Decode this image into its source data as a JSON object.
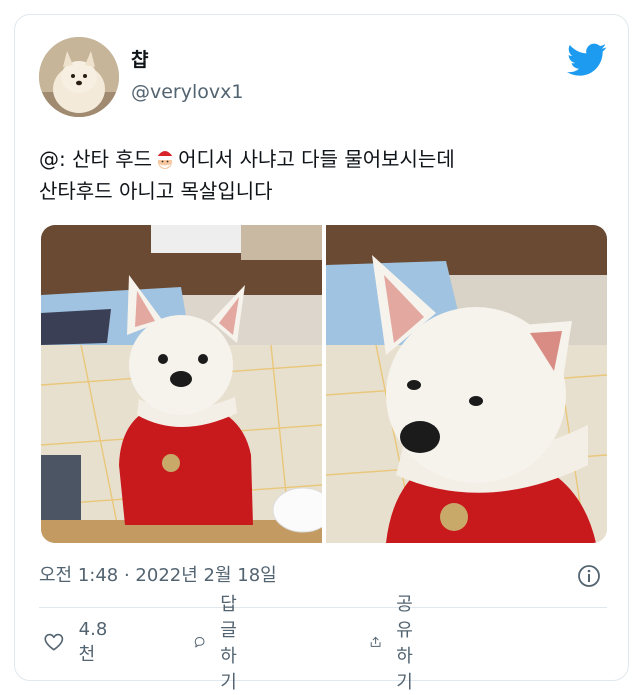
{
  "author": {
    "display_name": "챱",
    "handle": "@verylovx1",
    "avatar_icon": "dog-avatar"
  },
  "tweet": {
    "line1_before_emoji": "@: 산타 후드",
    "emoji": "santa-hat-emoji",
    "line1_after_emoji": "어디서 사냐고 다들 물어보시는데",
    "line2": "산타후드 아니고 목살입니다"
  },
  "timestamp": "오전 1:48 · 2022년 2월 18일",
  "actions": {
    "like_count": "4.8천",
    "reply_label": "답글하기",
    "share_label": "공유하기"
  },
  "colors": {
    "brand_blue": "#1d9bf0",
    "muted_text": "#536471",
    "red_sweater": "#c8191c"
  }
}
